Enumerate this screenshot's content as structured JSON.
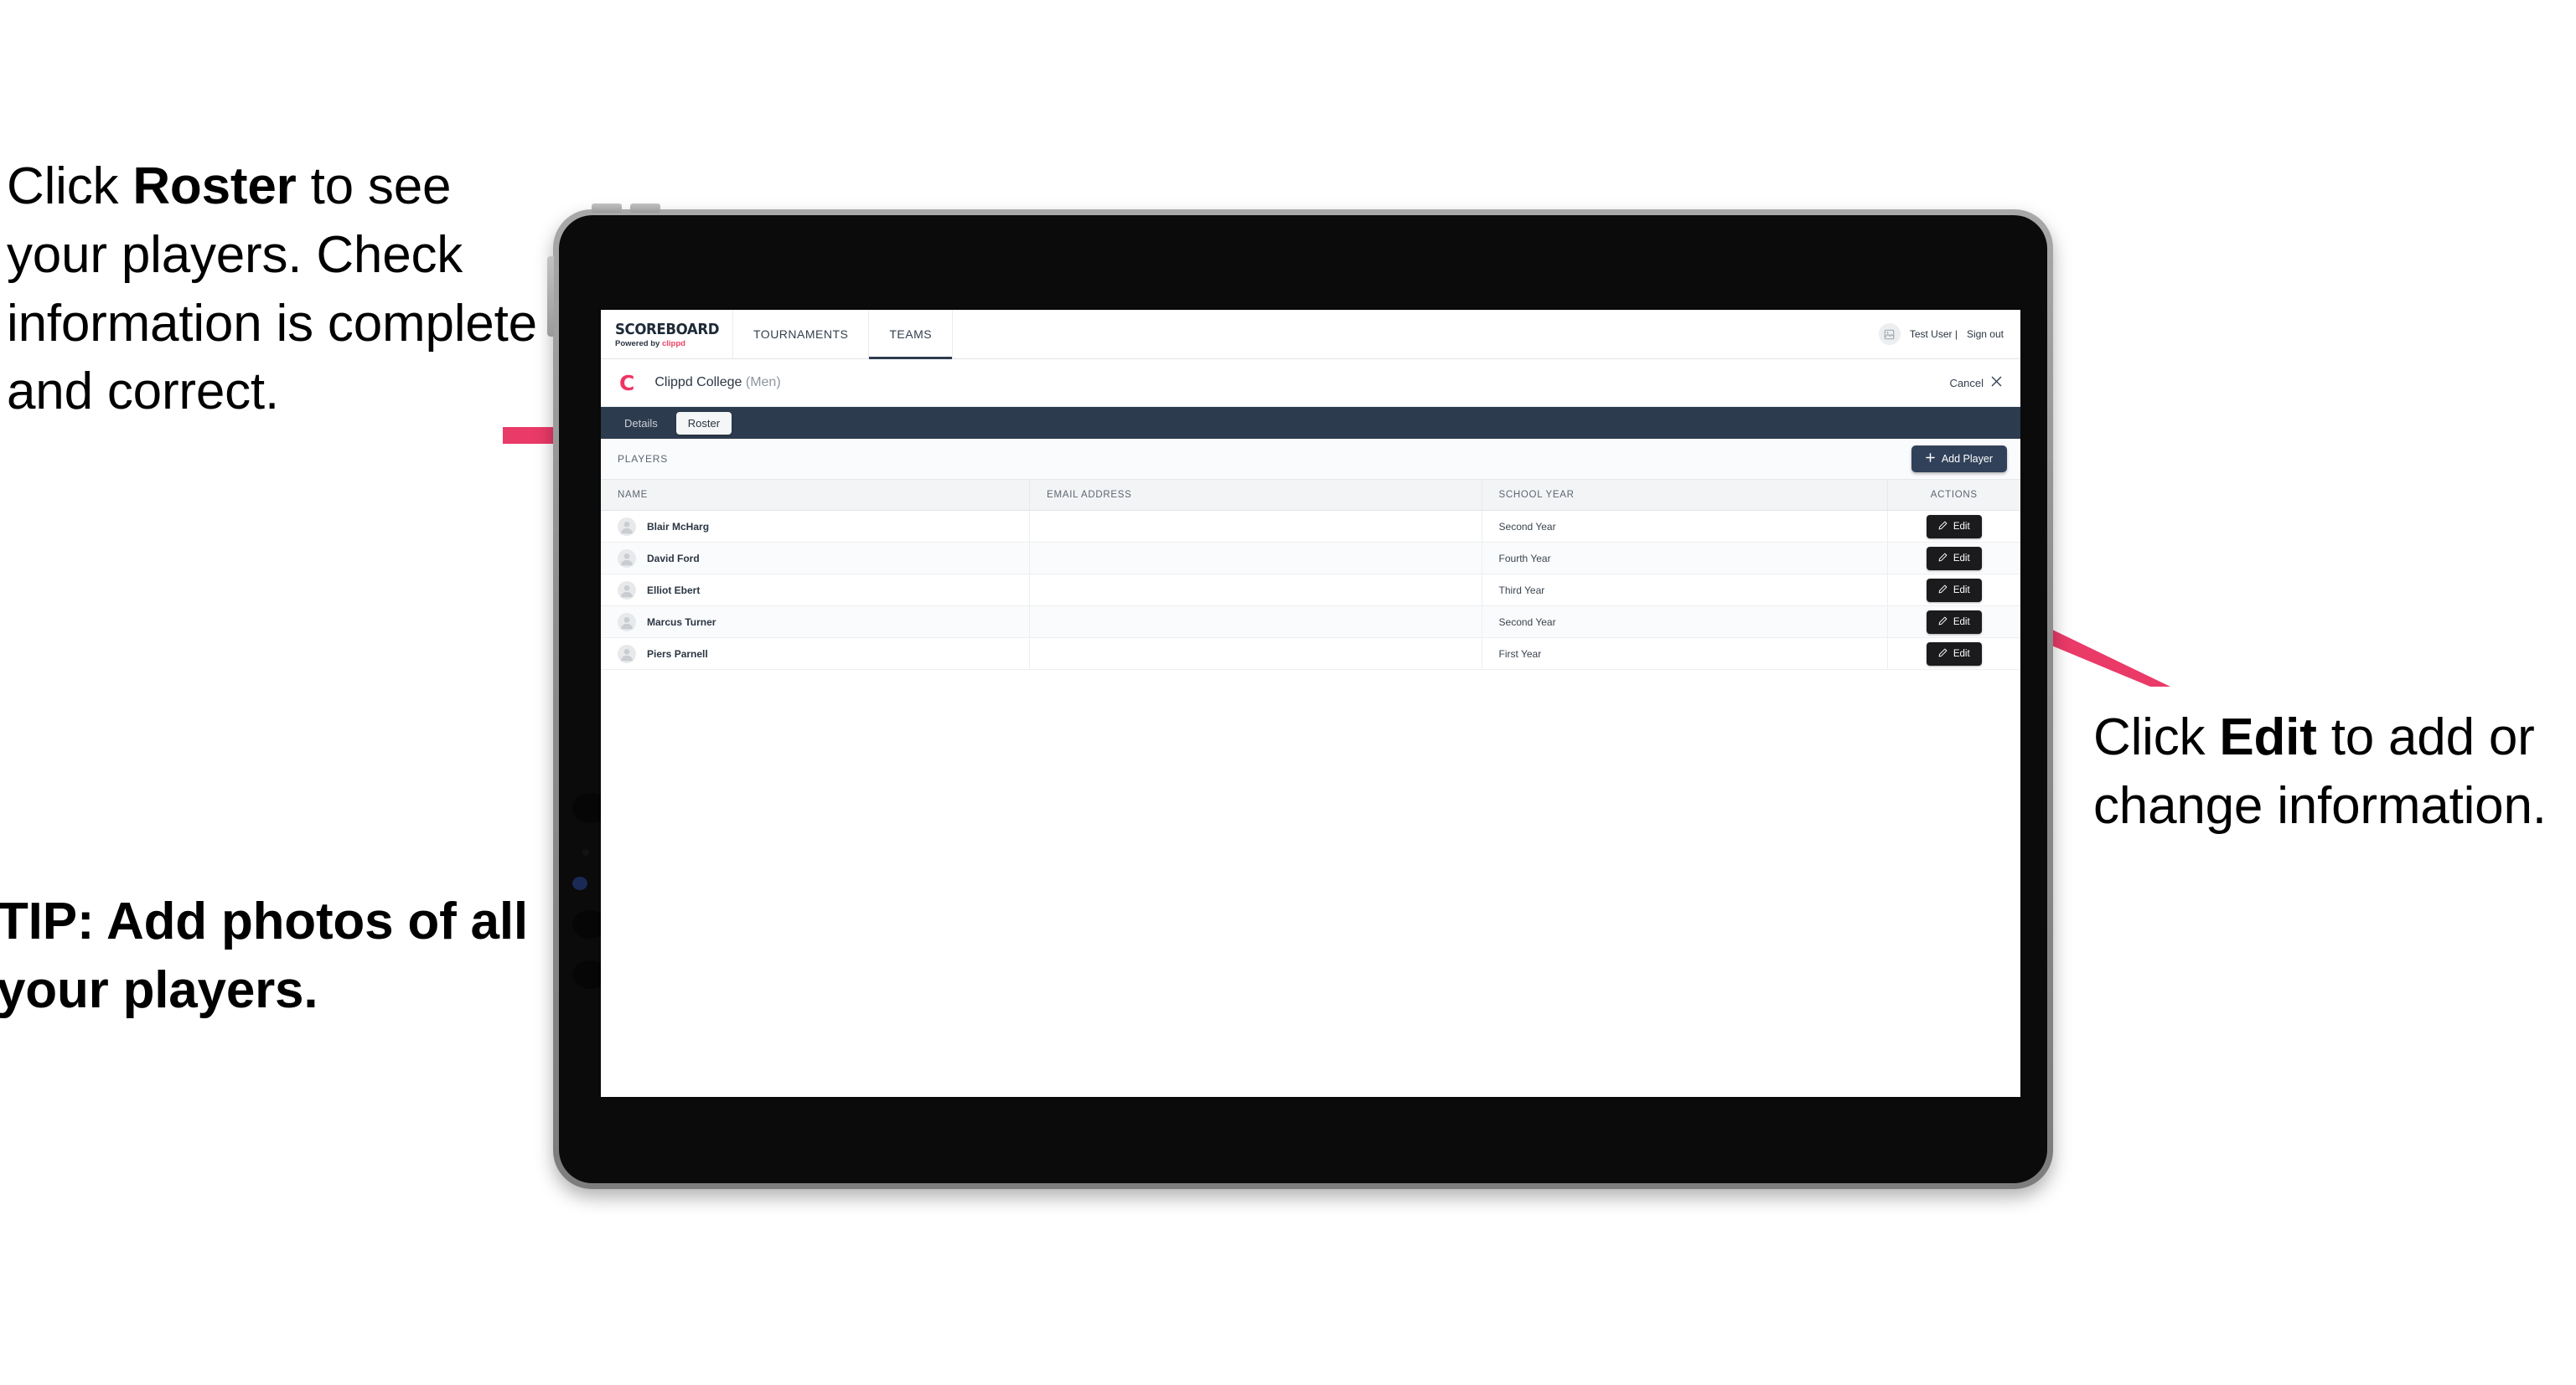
{
  "annotations": {
    "left_top": {
      "pre": "Click ",
      "bold": "Roster",
      "post": " to see your players. Check information is complete and correct."
    },
    "left_tip": "TIP: Add photos of all your players.",
    "right": {
      "pre": "Click ",
      "bold": "Edit",
      "post": " to add or change information."
    },
    "arrow_color": "#ea3a68"
  },
  "device": {
    "frame_color": "#8e8e8e",
    "bezel_color": "#0b0b0b"
  },
  "topnav": {
    "brand_title": "SCOREBOARD",
    "brand_sub_prefix": "Powered by ",
    "brand_sub_name": "clippd",
    "tabs": [
      {
        "label": "TOURNAMENTS",
        "active": false
      },
      {
        "label": "TEAMS",
        "active": true
      }
    ],
    "user_avatar_icon": "image-placeholder-icon",
    "user_name": "Test User |",
    "sign_out": "Sign out"
  },
  "team_header": {
    "logo_letter": "C",
    "logo_color": "#ee3462",
    "team_name": "Clippd College",
    "team_gender": "(Men)",
    "cancel_label": "Cancel",
    "cancel_icon": "close-icon"
  },
  "tabstrip": {
    "background": "#2d3b4e",
    "tabs": [
      {
        "label": "Details",
        "active": false
      },
      {
        "label": "Roster",
        "active": true
      }
    ]
  },
  "players_bar": {
    "section_label": "PLAYERS",
    "add_player_label": "Add Player",
    "add_player_icon": "plus-icon",
    "add_player_color": "#31415a"
  },
  "table": {
    "columns": [
      "NAME",
      "EMAIL ADDRESS",
      "SCHOOL YEAR",
      "ACTIONS"
    ],
    "edit_label": "Edit",
    "edit_icon": "pencil-icon",
    "rows": [
      {
        "name": "Blair McHarg",
        "email": "",
        "school_year": "Second Year",
        "avatar_icon": "person-placeholder-icon"
      },
      {
        "name": "David Ford",
        "email": "",
        "school_year": "Fourth Year",
        "avatar_icon": "person-placeholder-icon"
      },
      {
        "name": "Elliot Ebert",
        "email": "",
        "school_year": "Third Year",
        "avatar_icon": "person-placeholder-icon"
      },
      {
        "name": "Marcus Turner",
        "email": "",
        "school_year": "Second Year",
        "avatar_icon": "person-placeholder-icon"
      },
      {
        "name": "Piers Parnell",
        "email": "",
        "school_year": "First Year",
        "avatar_icon": "person-placeholder-icon"
      }
    ]
  }
}
